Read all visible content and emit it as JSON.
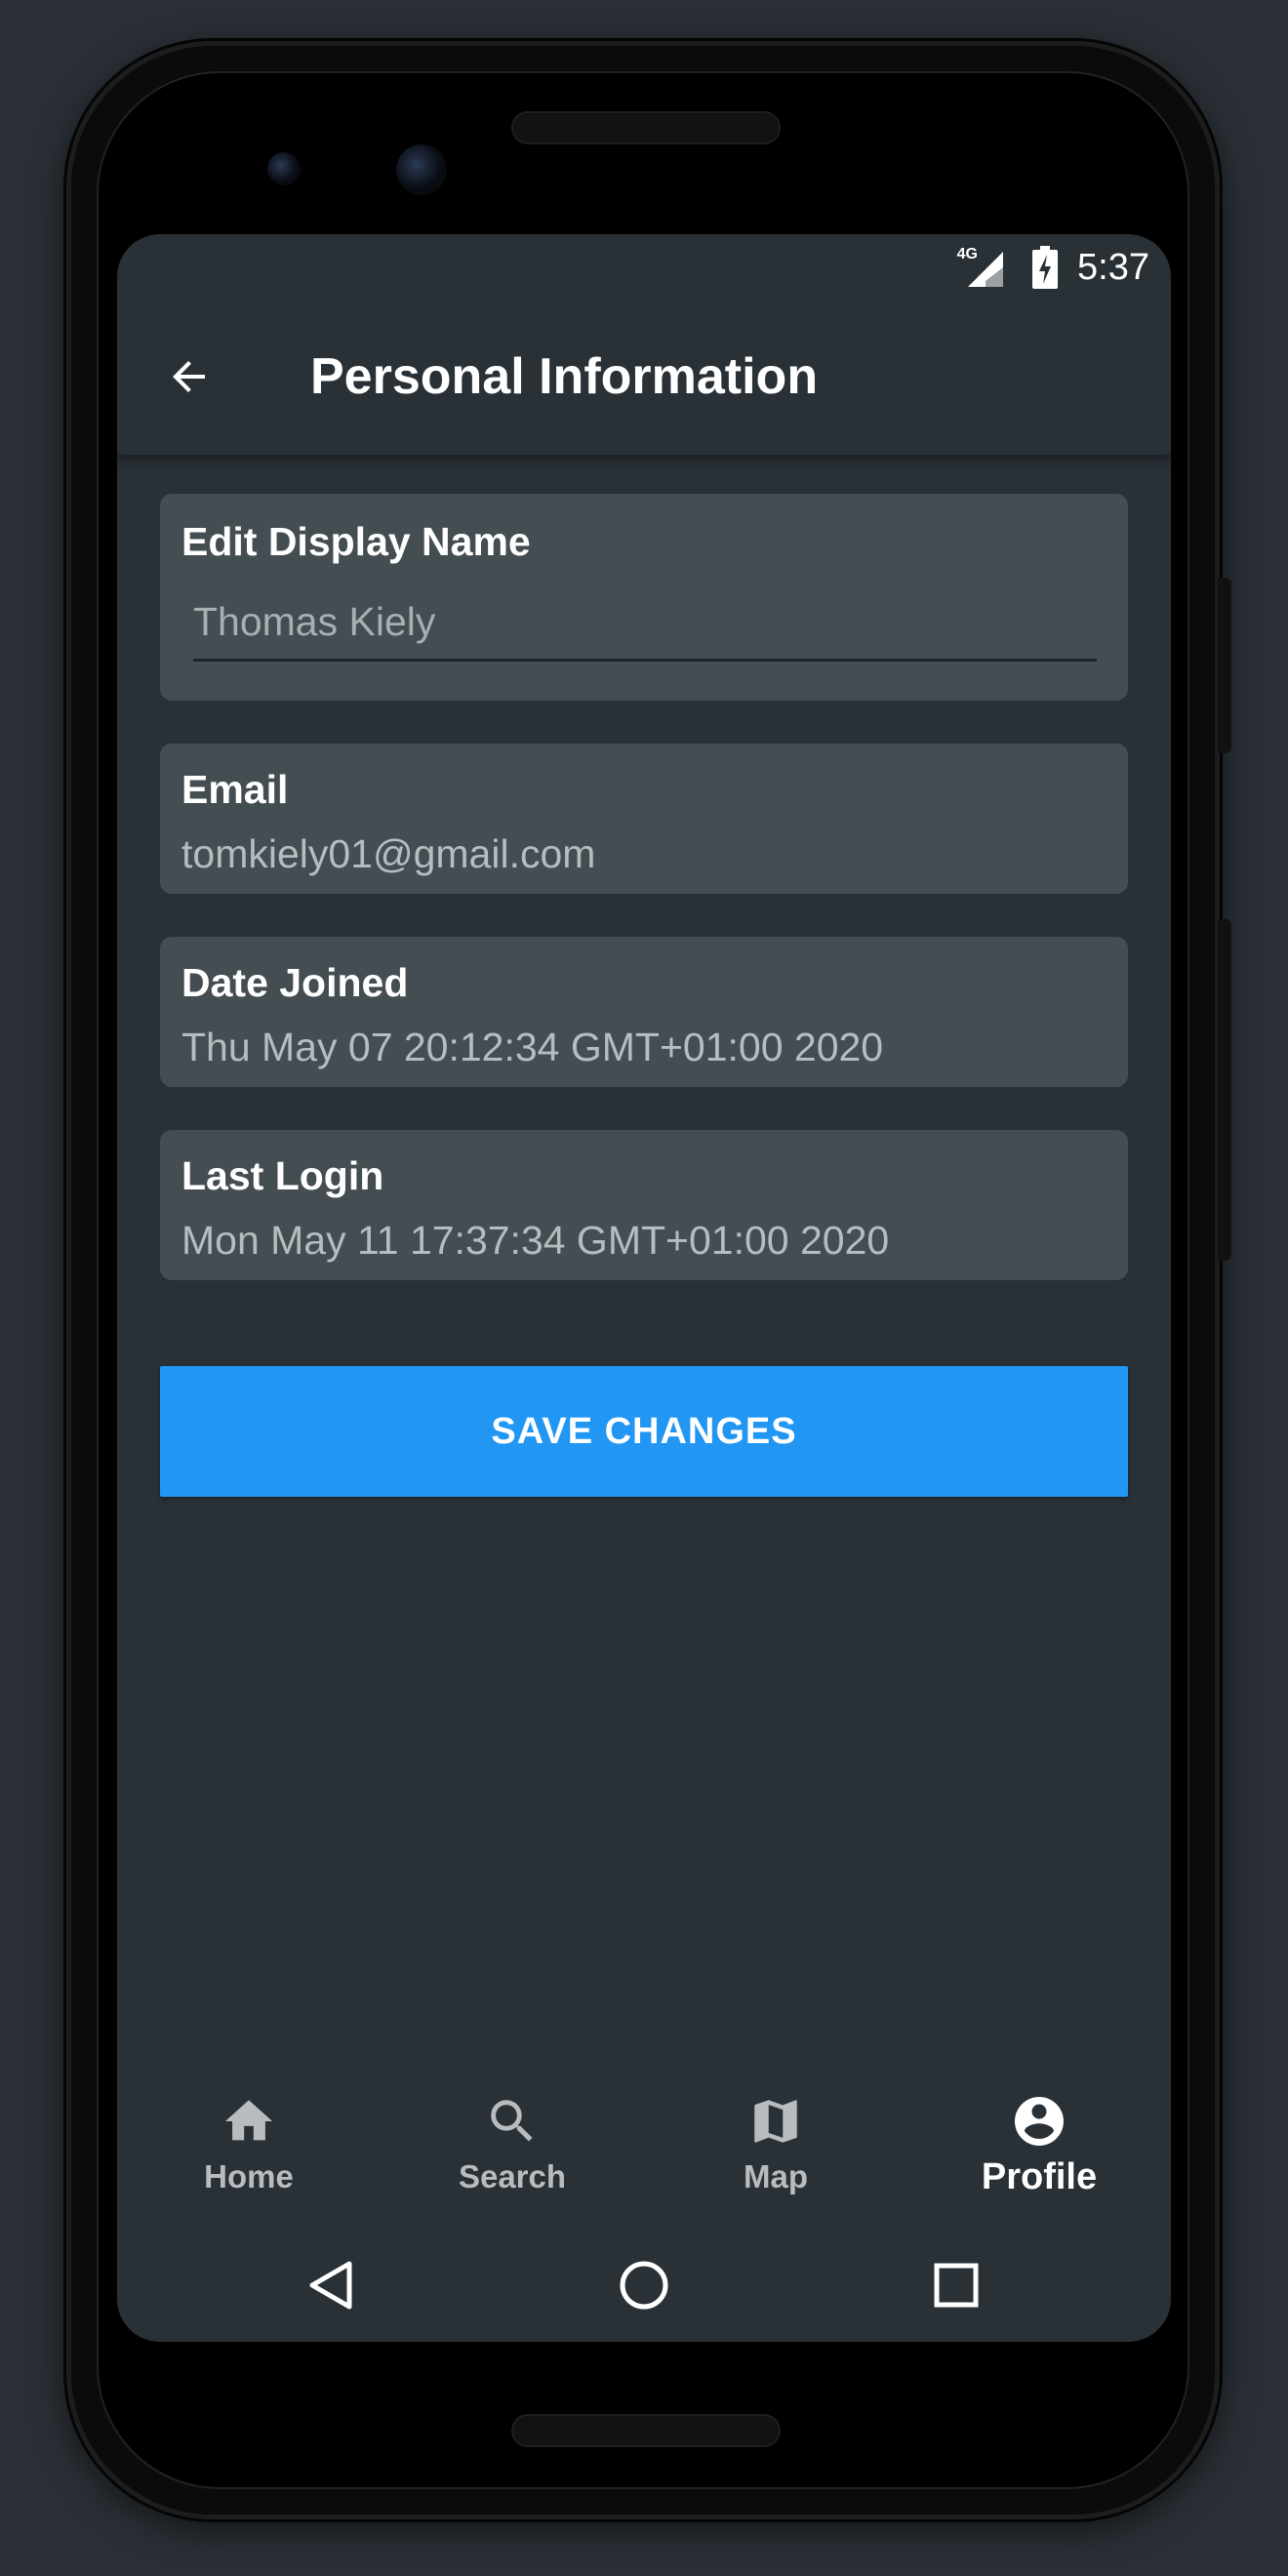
{
  "status_bar": {
    "network": "4G",
    "time": "5:37"
  },
  "app_bar": {
    "title": "Personal Information",
    "back_icon": "arrow-back-icon"
  },
  "display_name": {
    "label": "Edit Display Name",
    "value": "Thomas Kiely"
  },
  "email": {
    "label": "Email",
    "value": "tomkiely01@gmail.com"
  },
  "date_joined": {
    "label": "Date Joined",
    "value": "Thu May 07 20:12:34 GMT+01:00 2020"
  },
  "last_login": {
    "label": "Last Login",
    "value": "Mon May 11 17:37:34 GMT+01:00 2020"
  },
  "save_button": {
    "label": "SAVE CHANGES",
    "color": "#2196f3"
  },
  "bottom_nav": {
    "items": [
      {
        "label": "Home",
        "icon": "home-icon",
        "active": false
      },
      {
        "label": "Search",
        "icon": "search-icon",
        "active": false
      },
      {
        "label": "Map",
        "icon": "map-icon",
        "active": false
      },
      {
        "label": "Profile",
        "icon": "account-circle-icon",
        "active": true
      }
    ]
  },
  "system_nav": {
    "back": "triangle-back-icon",
    "home": "circle-home-icon",
    "recents": "square-recents-icon"
  },
  "colors": {
    "background": "#293036",
    "card": "#444d52",
    "accent": "#2196f3"
  }
}
